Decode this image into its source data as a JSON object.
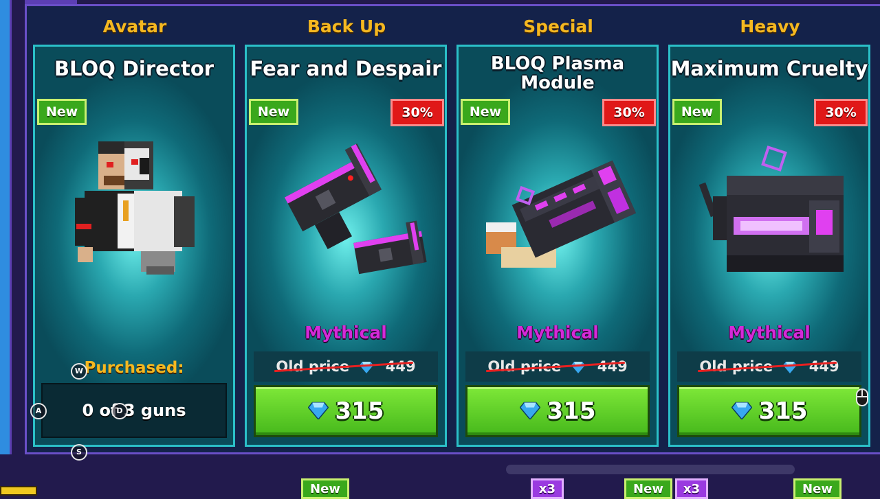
{
  "categories": [
    "Avatar",
    "Back Up",
    "Special",
    "Heavy"
  ],
  "cards": [
    {
      "title": "BLOQ Director",
      "new_label": "New",
      "purchased_label": "Purchased:",
      "owned_text": "0 of 3 guns"
    },
    {
      "title": "Fear and Despair",
      "new_label": "New",
      "discount": "30%",
      "rarity": "Mythical",
      "old_price_label": "Old price",
      "old_price": "449",
      "price": "315"
    },
    {
      "title": "BLOQ Plasma Module",
      "new_label": "New",
      "discount": "30%",
      "rarity": "Mythical",
      "old_price_label": "Old price",
      "old_price": "449",
      "price": "315"
    },
    {
      "title": "Maximum Cruelty",
      "new_label": "New",
      "discount": "30%",
      "rarity": "Mythical",
      "old_price_label": "Old price",
      "old_price": "449",
      "price": "315"
    }
  ],
  "key_hints": [
    "W",
    "A",
    "S",
    "D"
  ],
  "bottom_badges": [
    "New",
    "x3",
    "New",
    "x3",
    "New"
  ],
  "colors": {
    "category": "#f5b820",
    "card_border": "#2bc0c8",
    "rarity_mythical": "#d42ad8",
    "buy_button": "#5ccc24",
    "sale_badge": "#e01818",
    "new_badge": "#3aa81c"
  },
  "icons": [
    "gem-icon",
    "mouse-icon",
    "avatar-figure",
    "pistol-pair-icon",
    "plasma-module-icon",
    "heavy-cannon-icon"
  ]
}
